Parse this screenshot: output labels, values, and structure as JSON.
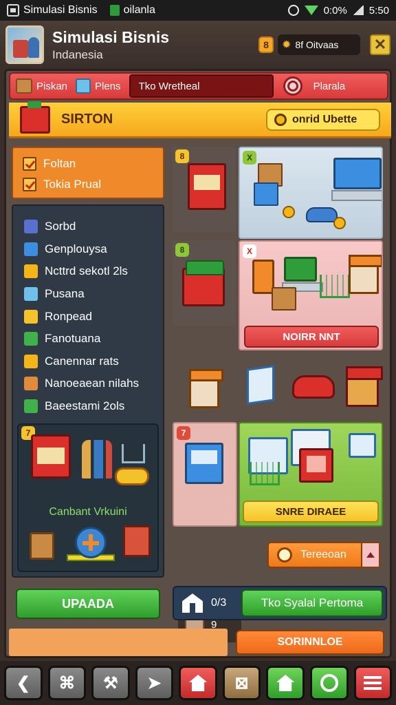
{
  "status_bar": {
    "app_name": "Simulasi Bisnis",
    "notification": "oilanla",
    "battery_text": "0:0%",
    "time": "5:50"
  },
  "header": {
    "title": "Simulasi Bisnis",
    "subtitle": "Indanesia",
    "coin_badge": "8",
    "currency_label": "8f Oitvaas"
  },
  "tabs": {
    "tab1": "Piskan",
    "tab2": "Plens",
    "active_field": "Tko Wretheal",
    "right": "Plarala"
  },
  "section": {
    "title": "SIRTON",
    "pill_label": "onrid Ubette"
  },
  "checkboxes": [
    {
      "label": "Foltan"
    },
    {
      "label": "Tokia Prual"
    }
  ],
  "menu": [
    {
      "label": "Sorbd",
      "color": "#5b6fd0"
    },
    {
      "label": "Genplouysa",
      "color": "#3c8fe0"
    },
    {
      "label": "Ncttrd sekotl 2ls",
      "color": "#f5b418"
    },
    {
      "label": "Pusana",
      "color": "#6ec2ea"
    },
    {
      "label": "Ronpead",
      "color": "#f5c42a"
    },
    {
      "label": "Fanotuana",
      "color": "#3fb34a"
    },
    {
      "label": "Canennar rats",
      "color": "#f5b418"
    },
    {
      "label": "Nanoeaean nilahs",
      "color": "#e08a3a"
    },
    {
      "label": "Baeestami 2ols",
      "color": "#3fb34a"
    }
  ],
  "promo": {
    "badge": "7",
    "label": "Canbant Vrkuini"
  },
  "tiles": {
    "stall_badge": "8",
    "online_badge": "X",
    "market_badge": "8",
    "promo_badge": "X",
    "promo_button": "NOIRR NNT",
    "buy1_badge": "7",
    "buy2_button": "SNRE DIRAEE"
  },
  "quantity": "9",
  "orange_button": "Tereeoan",
  "bottom": {
    "upgrade": "UPAADA",
    "stats_value": "0/3",
    "stats_action": "Tko Syalal Pertoma",
    "footer_button": "SORINNLOE"
  },
  "nav": [
    "back",
    "map",
    "build",
    "send",
    "home",
    "inventory",
    "shop",
    "settings",
    "menu"
  ]
}
